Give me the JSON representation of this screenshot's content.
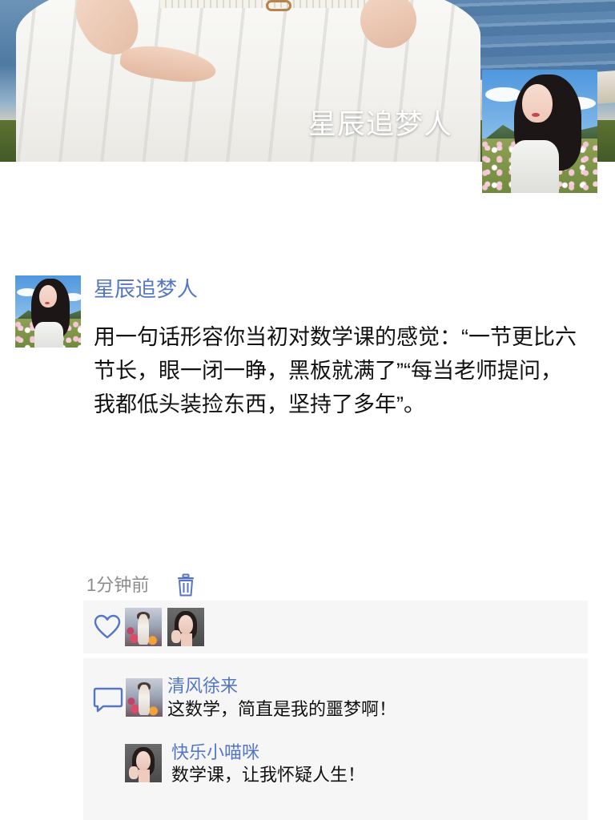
{
  "cover": {
    "nickname": "星辰追梦人"
  },
  "post": {
    "author": "星辰追梦人",
    "text": "用一句话形容你当初对数学课的感觉：“一节更比六节长，眼一闭一睁，黑板就满了”“每当老师提问，我都低头装捡东西，坚持了多年”。",
    "time": "1分钟前"
  },
  "comments": [
    {
      "author": "清风徐来",
      "text": "这数学，简直是我的噩梦啊！"
    },
    {
      "author": "快乐小喵咪",
      "text": "数学课，让我怀疑人生！"
    }
  ],
  "icons": {
    "delete": "trash-icon",
    "like": "heart-icon",
    "comment": "speech-bubble-icon"
  },
  "colors": {
    "link_blue": "#5476c5",
    "panel_bg": "#f6f6f6",
    "meta_gray": "#8c8c8c"
  }
}
